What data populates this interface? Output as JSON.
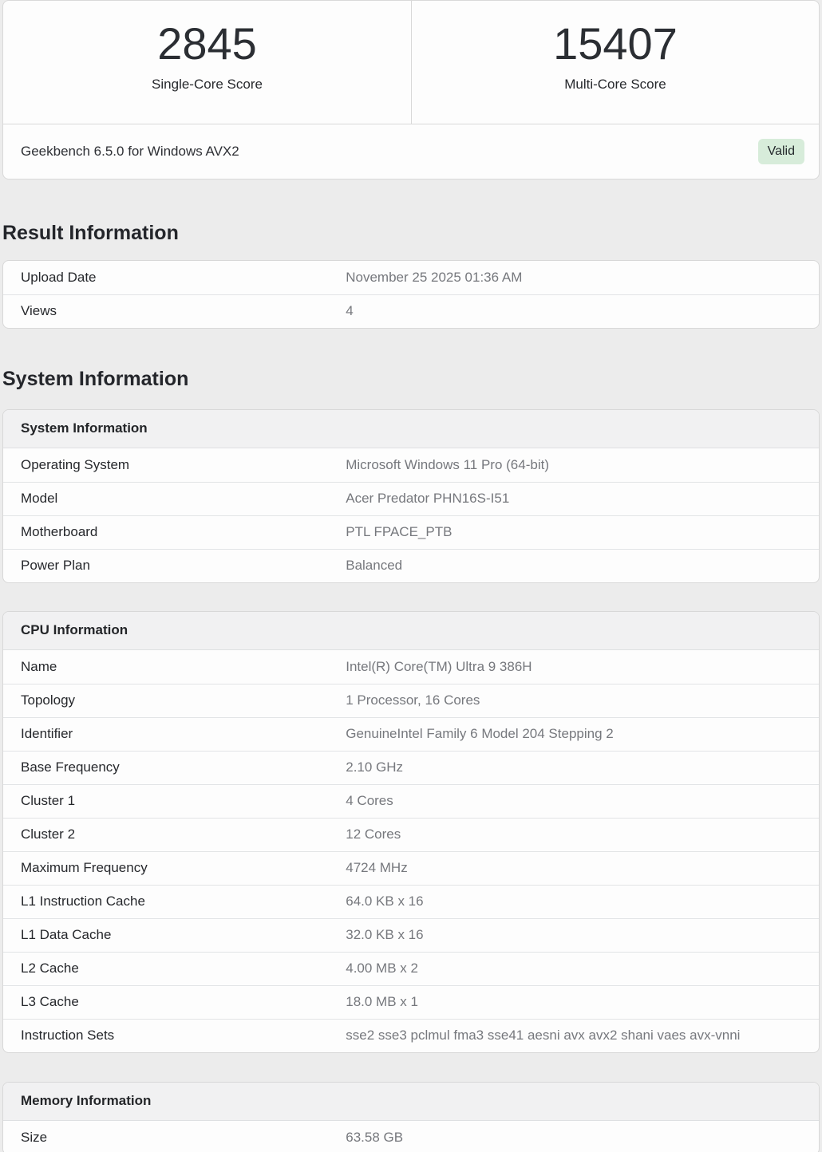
{
  "scores": {
    "single": {
      "value": "2845",
      "label": "Single-Core Score"
    },
    "multi": {
      "value": "15407",
      "label": "Multi-Core Score"
    }
  },
  "meta": {
    "benchmark": "Geekbench 6.5.0 for Windows AVX2",
    "badge": "Valid"
  },
  "colors": {
    "badge_bg": "#d7ecda",
    "page_bg": "#ececec",
    "value_text": "#76787d"
  },
  "result": {
    "heading": "Result Information",
    "rows": [
      [
        "Upload Date",
        "November 25 2025 01:36 AM"
      ],
      [
        "Views",
        "4"
      ]
    ]
  },
  "system_section_heading": "System Information",
  "system": {
    "header": "System Information",
    "rows": [
      [
        "Operating System",
        "Microsoft Windows 11 Pro (64-bit)"
      ],
      [
        "Model",
        "Acer Predator PHN16S-I51"
      ],
      [
        "Motherboard",
        "PTL FPACE_PTB"
      ],
      [
        "Power Plan",
        "Balanced"
      ]
    ]
  },
  "cpu": {
    "header": "CPU Information",
    "rows": [
      [
        "Name",
        "Intel(R) Core(TM) Ultra 9 386H"
      ],
      [
        "Topology",
        "1 Processor, 16 Cores"
      ],
      [
        "Identifier",
        "GenuineIntel Family 6 Model 204 Stepping 2"
      ],
      [
        "Base Frequency",
        "2.10 GHz"
      ],
      [
        "Cluster 1",
        "4 Cores"
      ],
      [
        "Cluster 2",
        "12 Cores"
      ],
      [
        "Maximum Frequency",
        "4724 MHz"
      ],
      [
        "L1 Instruction Cache",
        "64.0 KB x 16"
      ],
      [
        "L1 Data Cache",
        "32.0 KB x 16"
      ],
      [
        "L2 Cache",
        "4.00 MB x 2"
      ],
      [
        "L3 Cache",
        "18.0 MB x 1"
      ],
      [
        "Instruction Sets",
        "sse2 sse3 pclmul fma3 sse41 aesni avx avx2 shani vaes avx-vnni"
      ]
    ]
  },
  "memory": {
    "header": "Memory Information",
    "rows": [
      [
        "Size",
        "63.58 GB"
      ]
    ]
  }
}
